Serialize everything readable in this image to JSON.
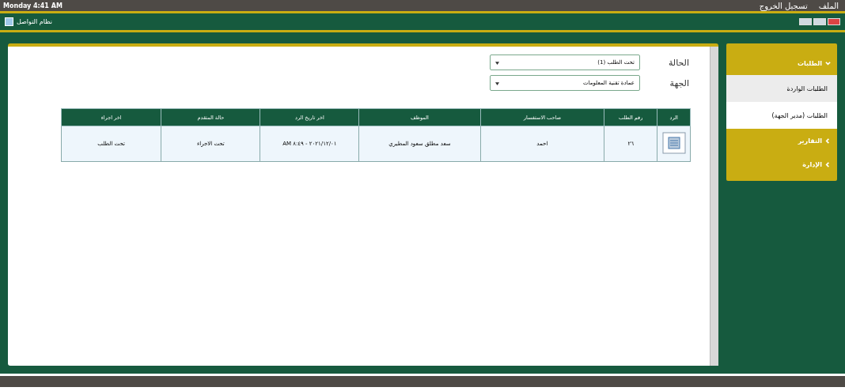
{
  "top_bar": {
    "clock": "Monday 4:41 AM",
    "menu": [
      "الملف",
      "تسجيل الخروج"
    ]
  },
  "app_bar": {
    "title": "نظام التواصل"
  },
  "filters": [
    {
      "label": "الحالة",
      "value": "تحت الطلب (1)"
    },
    {
      "label": "الجهة",
      "value": "عمادة تقنية المعلومات"
    }
  ],
  "table": {
    "columns": [
      "الرد",
      "رقم الطلب",
      "صاحب الاستفسار",
      "الموظف",
      "اخر تاريخ الرد",
      "حالة المتقدم",
      "اخر اجراء"
    ],
    "rows": [
      {
        "cells": [
          "",
          "٢٦",
          "احمد",
          "سعد مطلق سعود المطيري",
          "٢٠٢١/١٢/٠١ - ٨:٤٩ AM",
          "تحت الاجراء",
          "تحت الطلب"
        ]
      }
    ]
  },
  "sidebar": [
    {
      "label": "الطلبات",
      "expanded": true,
      "children": [
        {
          "label": "الطلبات الواردة",
          "selected": true
        },
        {
          "label": "الطلبات (مدير الجهة)",
          "selected": false
        }
      ]
    },
    {
      "label": "التقارير",
      "expanded": false
    },
    {
      "label": "الإدارة",
      "expanded": false
    }
  ]
}
